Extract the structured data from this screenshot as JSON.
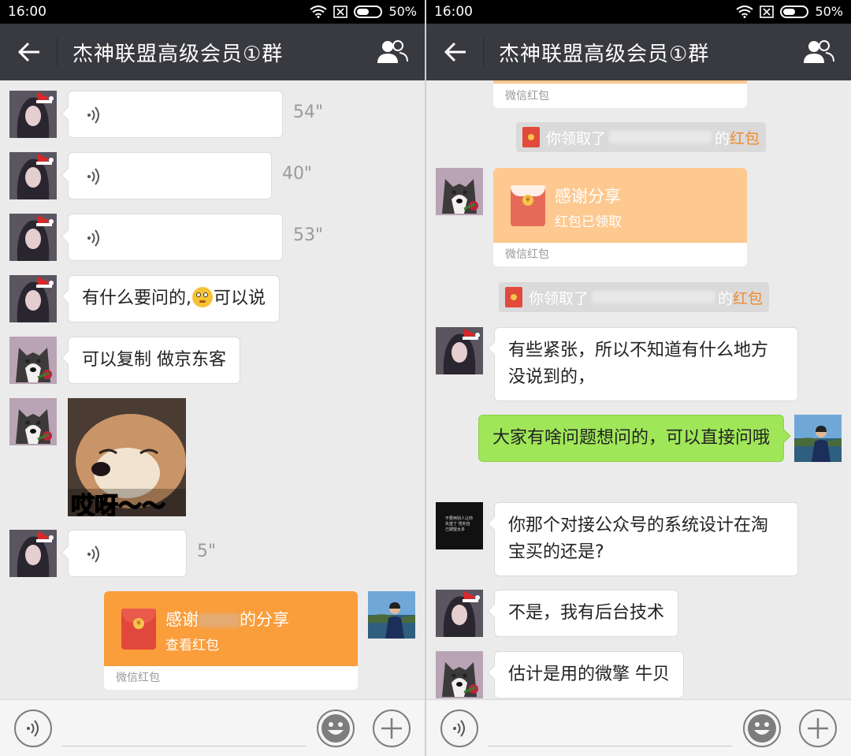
{
  "status": {
    "time": "16:00",
    "battery": "50%"
  },
  "header": {
    "title": "杰神联盟高级会员①群"
  },
  "left": {
    "voices": [
      {
        "duration": "54\""
      },
      {
        "duration": "40\""
      },
      {
        "duration": "53\""
      },
      {
        "duration": "5\""
      }
    ],
    "text1_a": "有什么要问的,",
    "text1_b": "可以说",
    "text2": "可以复制 做京东客",
    "sticker_caption": "哎呀～～",
    "redpacket": {
      "title_prefix": "感谢",
      "title_suffix": "的分享",
      "sub": "查看红包",
      "footer": "微信红包"
    }
  },
  "right": {
    "top_footer": "微信红包",
    "sys1": {
      "prefix": "你领取了",
      "mid": "的",
      "link": "红包"
    },
    "redpacket": {
      "title": "感谢分享",
      "sub": "红包已领取",
      "footer": "微信红包"
    },
    "sys2": {
      "prefix": "你领取了",
      "mid": "的",
      "link": "红包"
    },
    "msg1": "有些紧张，所以不知道有什么地方没说到的，",
    "msg2": "大家有啥问题想问的，可以直接问哦",
    "msg3": "你那个对接公众号的系统设计在淘宝买的还是?",
    "msg4": "不是，我有后台技术",
    "msg5": "估计是用的微擎 牛贝",
    "dark_avatar_text": "不要用别人让你失望了 怪你自己期望太多"
  },
  "colors": {
    "header_bg": "#393a3f",
    "chat_bg": "#ebebeb",
    "self_bubble": "#9fe658",
    "redpacket_orange": "#fa9d3b",
    "redpacket_opened": "#fdc990"
  }
}
